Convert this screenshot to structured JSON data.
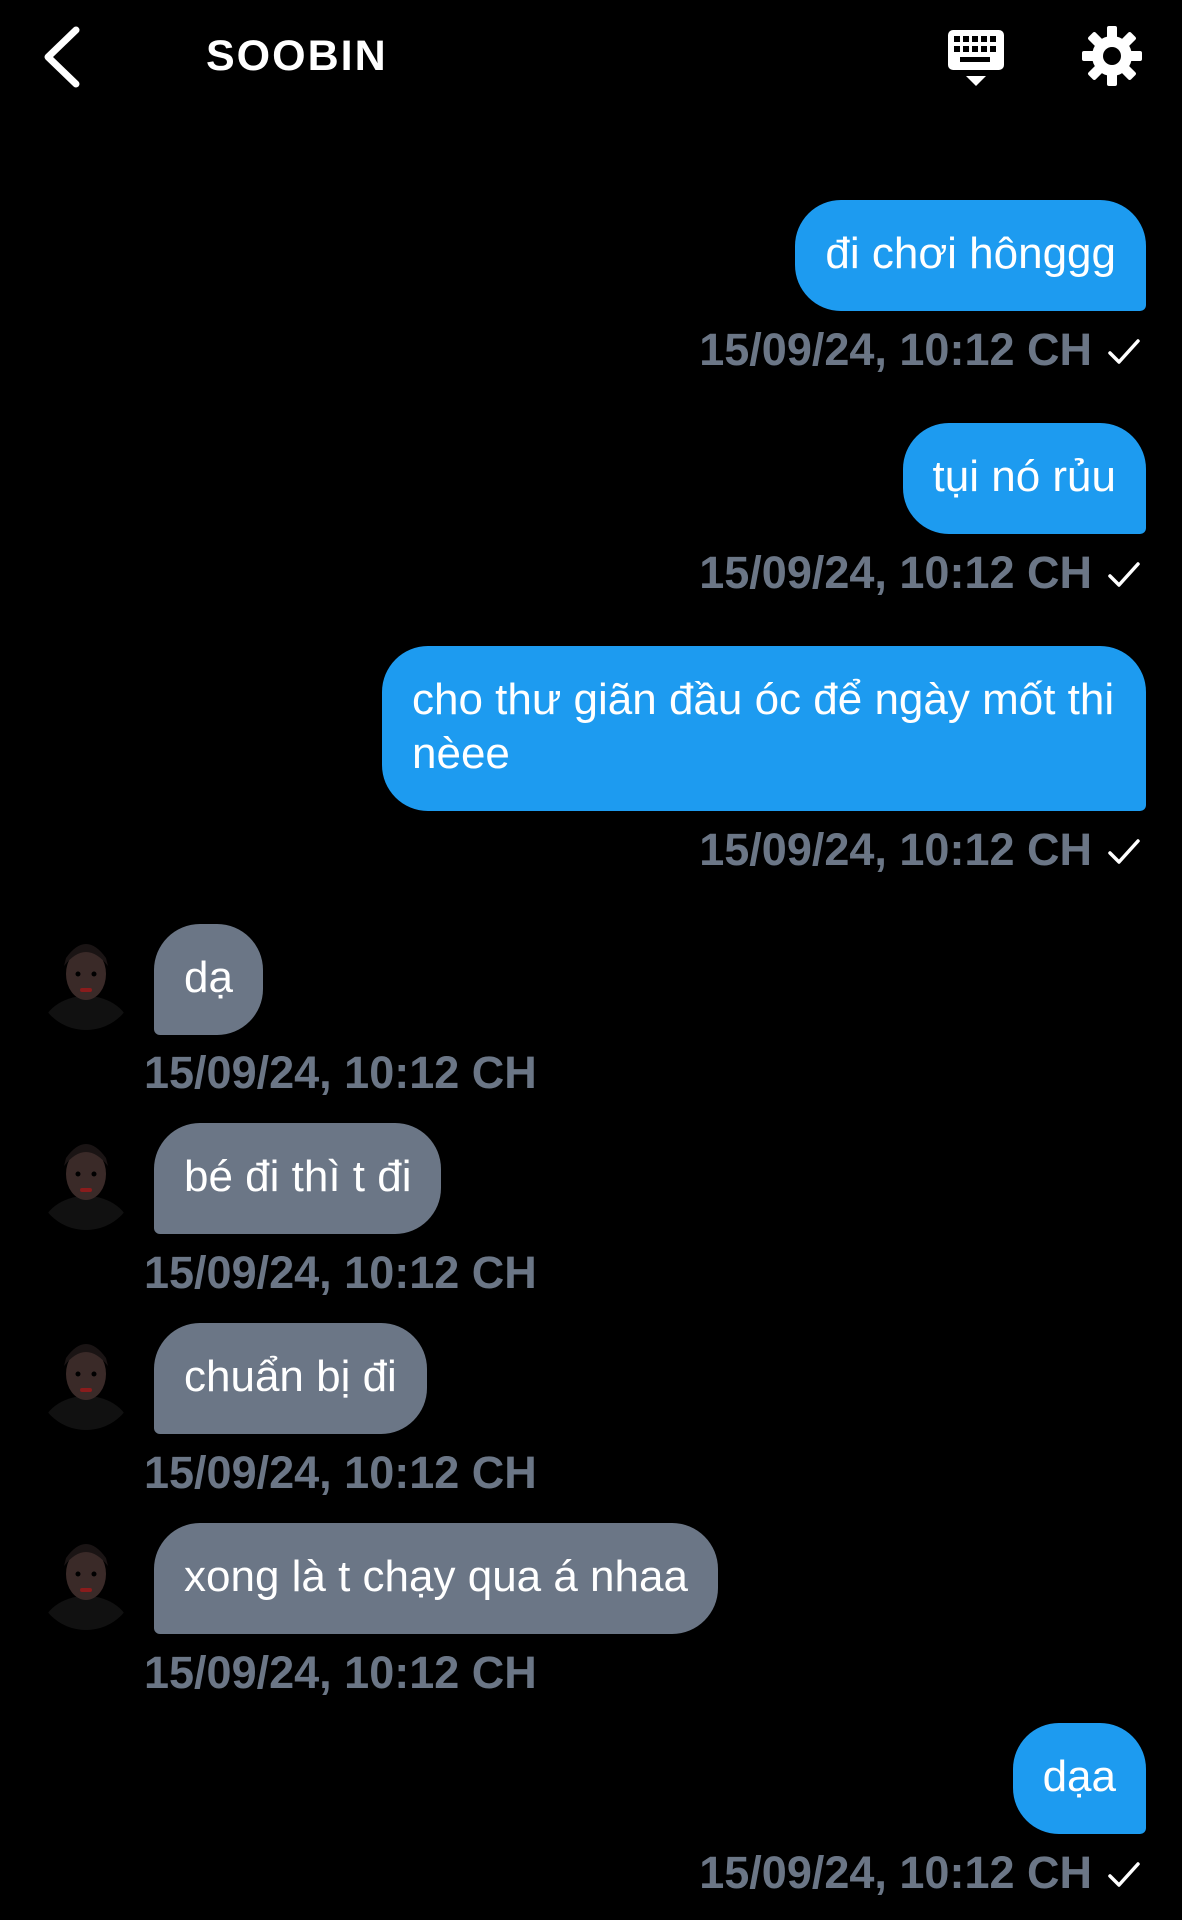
{
  "header": {
    "title": "SOOBIN",
    "back_icon": "chevron-left-icon",
    "keyboard_icon": "keyboard-icon",
    "settings_icon": "gear-icon"
  },
  "colors": {
    "background": "#000000",
    "sent_bubble": "#1d9bf0",
    "received_bubble": "#6b7686",
    "timestamp": "#6b7686"
  },
  "messages": [
    {
      "type": "sent",
      "text": "đi chơi hônggg",
      "time": "15/09/24, 10:12 CH",
      "read": true
    },
    {
      "type": "sent",
      "text": "tụi nó rủu",
      "time": "15/09/24, 10:12 CH",
      "read": true
    },
    {
      "type": "sent",
      "text": "cho thư giãn đầu óc để ngày mốt thi nèee",
      "time": "15/09/24, 10:12 CH",
      "read": true
    },
    {
      "type": "received",
      "text": "dạ",
      "time": "15/09/24, 10:12 CH"
    },
    {
      "type": "received",
      "text": "bé đi thì t đi",
      "time": "15/09/24, 10:12 CH"
    },
    {
      "type": "received",
      "text": "chuẩn bị đi",
      "time": "15/09/24, 10:12 CH"
    },
    {
      "type": "received",
      "text": "xong là t chạy qua á nhaa",
      "time": "15/09/24, 10:12 CH"
    },
    {
      "type": "sent",
      "text": "dạa",
      "time": "15/09/24, 10:12 CH",
      "read": true
    }
  ]
}
